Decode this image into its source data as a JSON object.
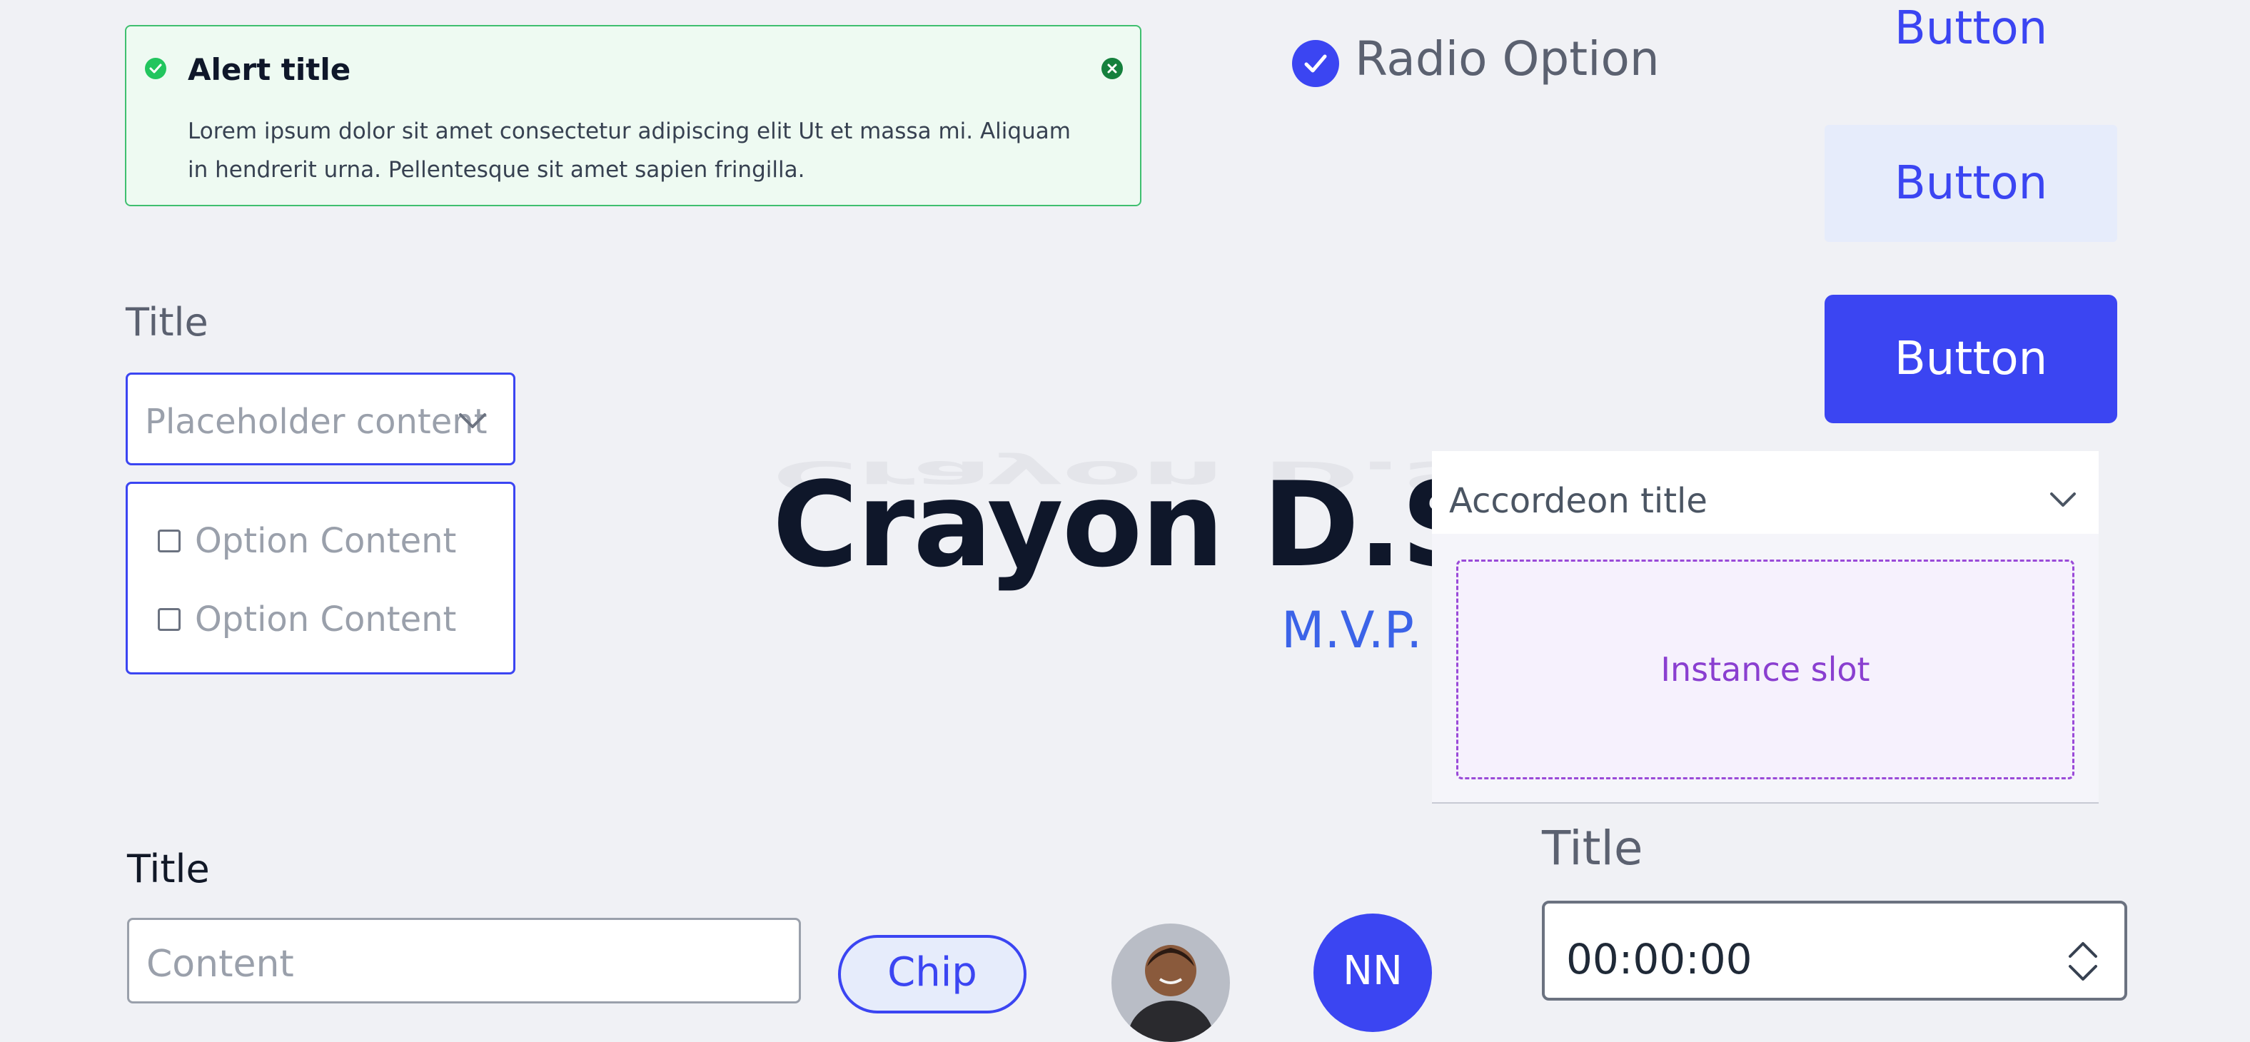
{
  "alert": {
    "title": "Alert title",
    "body": "Lorem ipsum dolor sit amet consectetur adipiscing elit Ut et massa mi. Aliquam in hendrerit urna. Pellentesque sit amet sapien fringilla.",
    "success_color": "#22c55e",
    "icons": [
      "check-circle-icon",
      "close-icon"
    ]
  },
  "radio": {
    "label": "Radio Option",
    "checked": true
  },
  "buttons": {
    "text_button": "Button",
    "secondary_button": "Button",
    "primary_button": "Button",
    "accent_color": "#3b45f2"
  },
  "select": {
    "title": "Title",
    "placeholder": "Placeholder content",
    "options": [
      "Option Content",
      "Option Content"
    ]
  },
  "brand": {
    "name": "Crayon D.S.",
    "tagline": "M.V.P."
  },
  "accordion": {
    "title": "Accordeon title",
    "slot_label": "Instance slot"
  },
  "text_input": {
    "title": "Title",
    "placeholder": "Content"
  },
  "chip": {
    "label": "Chip"
  },
  "avatars": {
    "initials": "NN"
  },
  "time_input": {
    "title": "Title",
    "value": "00:00:00"
  }
}
